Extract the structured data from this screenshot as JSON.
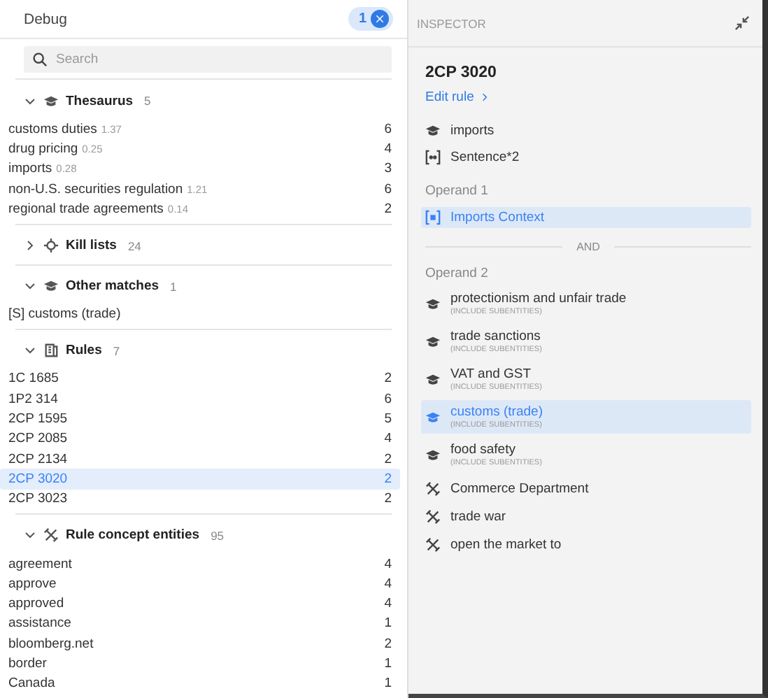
{
  "debug": {
    "title": "Debug",
    "badge_count": "1",
    "search": {
      "placeholder": "Search"
    },
    "sections": [
      {
        "kind": "concept",
        "title": "Thesaurus",
        "count": "5",
        "expanded": true,
        "items": [
          {
            "label": "customs duties",
            "score": "1.37",
            "count": "6",
            "selected": false
          },
          {
            "label": "drug pricing",
            "score": "0.25",
            "count": "4",
            "selected": false
          },
          {
            "label": "imports",
            "score": "0.28",
            "count": "3",
            "selected": false
          },
          {
            "label": "non-U.S. securities regulation",
            "score": "1.21",
            "count": "6",
            "selected": false
          },
          {
            "label": "regional trade agreements",
            "score": "0.14",
            "count": "2",
            "selected": false
          }
        ]
      },
      {
        "kind": "target",
        "title": "Kill lists",
        "count": "24",
        "expanded": false
      },
      {
        "kind": "concept",
        "title": "Other matches",
        "count": "1",
        "expanded": true,
        "items": [
          {
            "label": "[S] customs (trade)",
            "selected": false
          }
        ]
      },
      {
        "kind": "document",
        "title": "Rules",
        "count": "7",
        "expanded": true,
        "items": [
          {
            "label": "1C 1685",
            "count": "2",
            "selected": false
          },
          {
            "label": "1P2 314",
            "count": "6",
            "selected": false
          },
          {
            "label": "2CP 1595",
            "count": "5",
            "selected": false
          },
          {
            "label": "2CP 2085",
            "count": "4",
            "selected": false
          },
          {
            "label": "2CP 2134",
            "count": "2",
            "selected": false
          },
          {
            "label": "2CP 3020",
            "count": "2",
            "selected": true
          },
          {
            "label": "2CP 3023",
            "count": "2",
            "selected": false
          }
        ]
      },
      {
        "kind": "tools",
        "title": "Rule concept entities",
        "count": "95",
        "expanded": true,
        "items": [
          {
            "label": "agreement",
            "count": "4",
            "selected": false
          },
          {
            "label": "approve",
            "count": "4",
            "selected": false
          },
          {
            "label": "approved",
            "count": "4",
            "selected": false
          },
          {
            "label": "assistance",
            "count": "1",
            "selected": false
          },
          {
            "label": "bloomberg.net",
            "count": "2",
            "selected": false
          },
          {
            "label": "border",
            "count": "1",
            "selected": false
          },
          {
            "label": "Canada",
            "count": "1",
            "selected": false
          }
        ]
      }
    ]
  },
  "inspector": {
    "title": "INSPECTOR",
    "rule_name": "2CP 3020",
    "edit_link": "Edit rule",
    "summary": [
      {
        "kind": "concept",
        "label": "imports"
      },
      {
        "kind": "sentence",
        "label": "Sentence*2"
      }
    ],
    "operands": [
      {
        "label": "Operand 1",
        "items": [
          {
            "kind": "context",
            "label": "Imports Context",
            "selected": true
          }
        ]
      },
      {
        "label": "Operand 2",
        "items": [
          {
            "kind": "concept",
            "label": "protectionism and unfair trade",
            "sublabel": "(INCLUDE SUBENTITIES)",
            "selected": false
          },
          {
            "kind": "concept",
            "label": "trade sanctions",
            "sublabel": "(INCLUDE SUBENTITIES)",
            "selected": false
          },
          {
            "kind": "concept",
            "label": "VAT and GST",
            "sublabel": "(INCLUDE SUBENTITIES)",
            "selected": false
          },
          {
            "kind": "concept",
            "label": "customs (trade)",
            "sublabel": "(INCLUDE SUBENTITIES)",
            "selected": true
          },
          {
            "kind": "concept",
            "label": "food safety",
            "sublabel": "(INCLUDE SUBENTITIES)",
            "selected": false
          },
          {
            "kind": "tools",
            "label": "Commerce Department",
            "selected": false
          },
          {
            "kind": "tools",
            "label": "trade war",
            "selected": false
          },
          {
            "kind": "tools",
            "label": "open the market to",
            "selected": false
          }
        ]
      }
    ],
    "operator": "AND"
  }
}
